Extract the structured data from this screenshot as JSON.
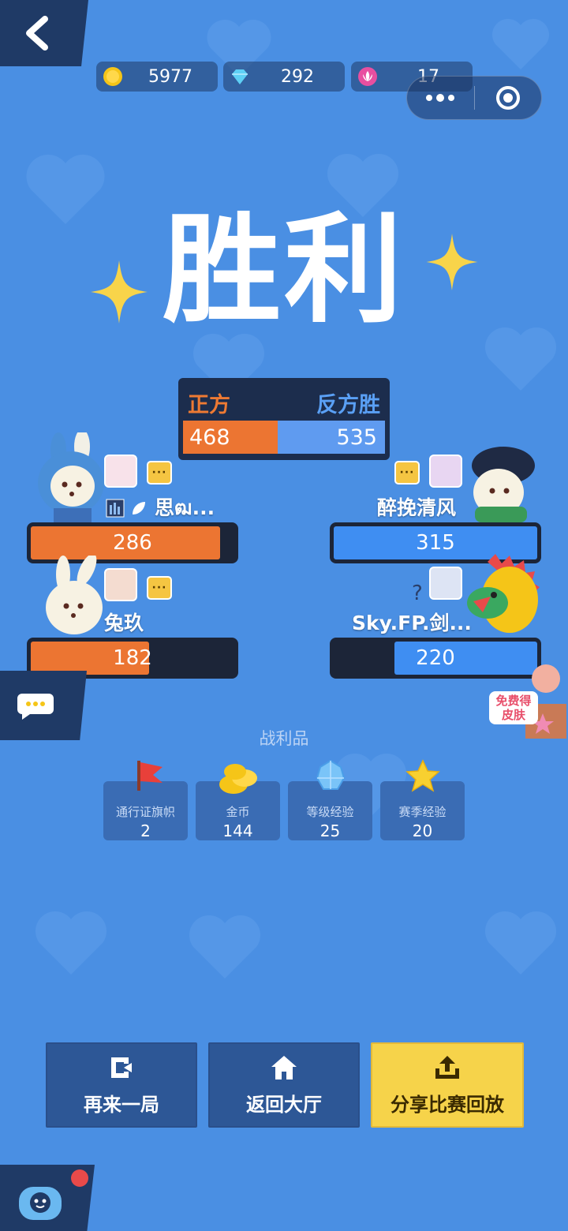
{
  "currencies": [
    {
      "name": "gold-coin",
      "value": "5977",
      "color": "#f5c518"
    },
    {
      "name": "diamond",
      "value": "292",
      "color": "#5ed0f5"
    },
    {
      "name": "lotus-token",
      "value": "17",
      "color": "#e84fa0"
    }
  ],
  "title": "胜利",
  "scoreboard": {
    "left_label": "正方",
    "right_label": "反方胜",
    "left_score": "468",
    "right_score": "535",
    "left_color": "#ec7532",
    "right_color": "#5f9bf0"
  },
  "players": {
    "left_1": {
      "name": "思ฒ...",
      "score": "286",
      "fill_fraction": 0.93
    },
    "left_2": {
      "name": "兔玖",
      "score": "182",
      "fill_fraction": 0.58
    },
    "right_1": {
      "name": "醉挽清风",
      "score": "315",
      "fill_fraction": 1.0
    },
    "right_2": {
      "name": "Sky.FP.剑...",
      "score": "220",
      "fill_fraction": 0.7
    }
  },
  "chat_bubble_text": "···",
  "free_skin": {
    "line1": "免费得",
    "line2": "皮肤"
  },
  "loot": {
    "title": "战利品",
    "items": [
      {
        "label": "通行证旗帜",
        "count": "2",
        "icon": "red-flag-icon"
      },
      {
        "label": "金币",
        "count": "144",
        "icon": "gold-coins-icon"
      },
      {
        "label": "等级经验",
        "count": "25",
        "icon": "blue-star-icon"
      },
      {
        "label": "赛季经验",
        "count": "20",
        "icon": "gold-star-icon"
      }
    ]
  },
  "buttons": {
    "replay": "再来一局",
    "lobby": "返回大厅",
    "share": "分享比赛回放"
  }
}
